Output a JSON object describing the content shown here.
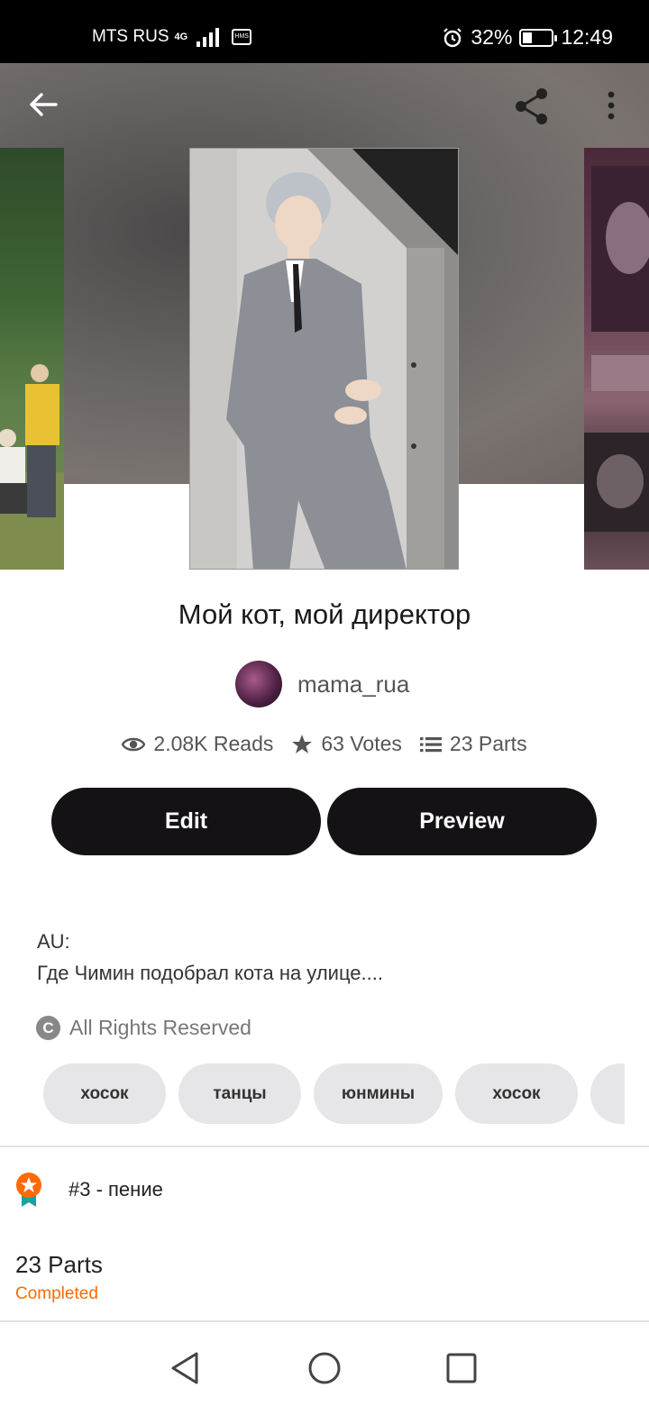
{
  "status_bar": {
    "carrier": "MTS RUS",
    "network": "4G",
    "battery": "32%",
    "battery_level": 0.32,
    "time": "12:49"
  },
  "header": {
    "back_icon": "arrow-left-icon",
    "share_icon": "share-icon",
    "more_icon": "more-vertical-icon"
  },
  "story": {
    "title": "Мой кот, мой директор",
    "author": "mama_rua",
    "stats": {
      "reads": "2.08K Reads",
      "votes": "63 Votes",
      "parts": "23 Parts"
    },
    "buttons": {
      "edit": "Edit",
      "preview": "Preview"
    },
    "description": [
      "AU:",
      "Где Чимин подобрал кота на улице...."
    ],
    "rights": "All Rights Reserved",
    "tags": [
      "хосок",
      "танцы",
      "юнмины",
      "хосок",
      ""
    ],
    "rank": "#3 - пение",
    "parts_count": "23 Parts",
    "status": "Completed"
  },
  "colors": {
    "button_bg": "#141214",
    "accent_orange": "#ff6a00",
    "tag_bg": "#e6e5e7"
  }
}
